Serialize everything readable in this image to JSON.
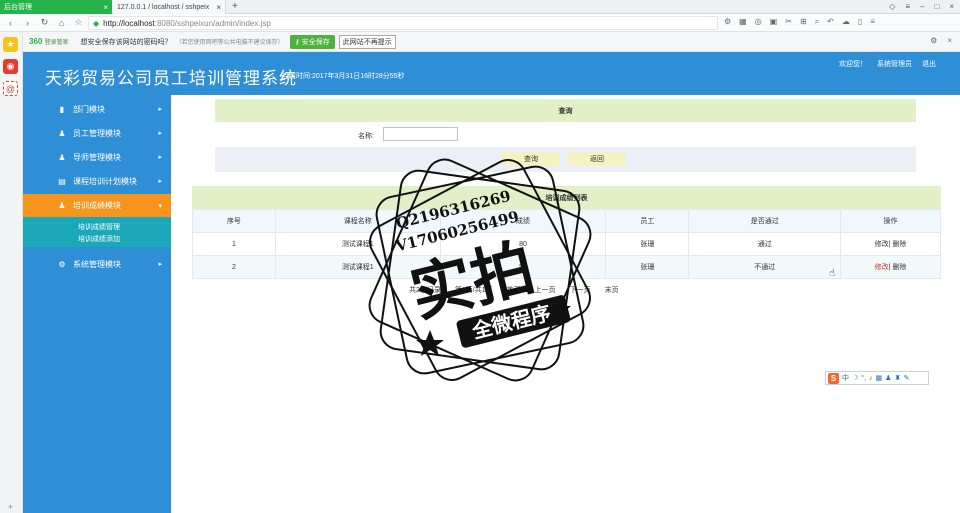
{
  "browser": {
    "tabs": [
      {
        "label": "后台管理",
        "active": true
      },
      {
        "label": "127.0.0.1 / localhost / sshpeix",
        "active": false
      }
    ],
    "url_host": "http://localhost",
    "url_path": ":8080/sshpeixun/admin/index.jsp"
  },
  "pwbar": {
    "brand": "360",
    "brand_sub": "登录管家",
    "question": "想安全保存该网站的密码吗？",
    "note": "（若您使用网吧等公共电脑不建议保存）",
    "save_label": "安全保存",
    "noask_label": "此网站不再提示"
  },
  "app": {
    "title": "天彩贸易公司员工培训管理系统",
    "time_label": "当前时间:2017年3月31日16时28分55秒",
    "welcome": "欢迎您！",
    "user": "系统管理员",
    "logout": "退出"
  },
  "sidebar": {
    "items": [
      {
        "label": "部门模块",
        "icon": "book-icon"
      },
      {
        "label": "员工管理模块",
        "icon": "users-icon"
      },
      {
        "label": "导师管理模块",
        "icon": "users-icon"
      },
      {
        "label": "课程培训计划模块",
        "icon": "calendar-icon"
      },
      {
        "label": "培训成绩模块",
        "icon": "users-icon"
      },
      {
        "label": "系统管理模块",
        "icon": "gear-icon"
      }
    ],
    "submenu": [
      "培训成绩管理",
      "培训成绩添加"
    ]
  },
  "query": {
    "header": "查询",
    "name_label": "名称:",
    "name_value": "",
    "search_label": "查询",
    "back_label": "返回"
  },
  "list": {
    "header": "培训成绩列表",
    "columns": [
      "序号",
      "课程名称",
      "成绩",
      "员工",
      "是否通过",
      "操作"
    ],
    "rows": [
      {
        "no": "1",
        "course": "测试课程1",
        "score": "80",
        "employee": "张珊",
        "passed": "通过"
      },
      {
        "no": "2",
        "course": "测试课程1",
        "score": "50",
        "employee": "张珊",
        "passed": "不通过"
      }
    ],
    "edit_label": "修改",
    "delete_label": "删除"
  },
  "pager": {
    "summary": "共2条记录",
    "pages": "第1页/共1页",
    "first": "首页",
    "prev": "上一页",
    "next": "下一页",
    "last": "末页"
  },
  "watermark": {
    "line1": "Q2196316269",
    "line2": "V17060256499",
    "main": "实拍",
    "sub": "全微程序"
  },
  "colors": {
    "header_blue": "#2f8fd6",
    "active_orange": "#f7941d",
    "sub_teal": "#1ba8b8",
    "table_head": "#e3efc7"
  }
}
